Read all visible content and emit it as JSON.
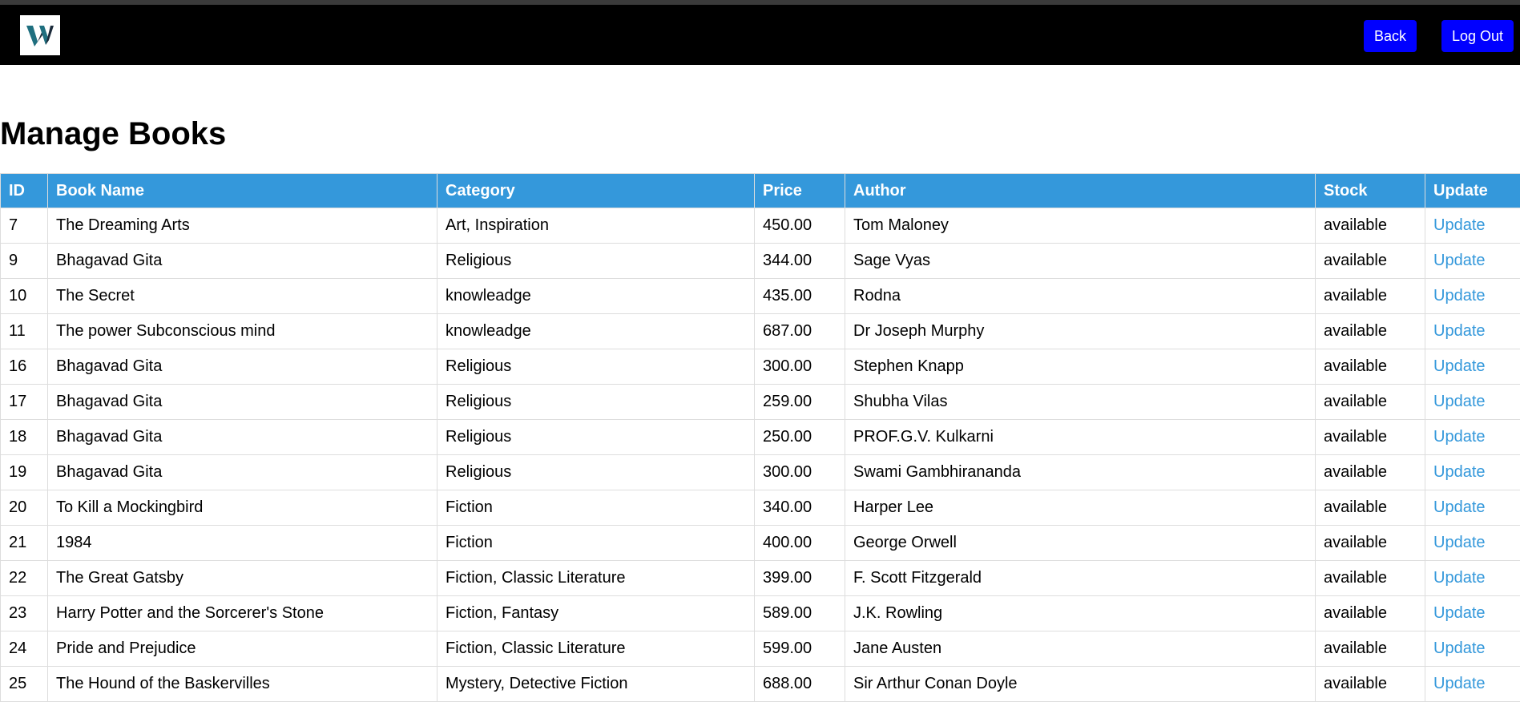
{
  "navbar": {
    "back_label": "Back",
    "logout_label": "Log Out"
  },
  "page_title": "Manage Books",
  "table": {
    "headers": [
      "ID",
      "Book Name",
      "Category",
      "Price",
      "Author",
      "Stock",
      "Update"
    ],
    "rows": [
      {
        "id": "7",
        "name": "The Dreaming Arts",
        "category": "Art, Inspiration",
        "price": "450.00",
        "author": "Tom Maloney",
        "stock": "available",
        "action": "Update"
      },
      {
        "id": "9",
        "name": "Bhagavad Gita",
        "category": "Religious",
        "price": "344.00",
        "author": "Sage Vyas",
        "stock": "available",
        "action": "Update"
      },
      {
        "id": "10",
        "name": "The Secret",
        "category": "knowleadge",
        "price": "435.00",
        "author": "Rodna",
        "stock": "available",
        "action": "Update"
      },
      {
        "id": "11",
        "name": "The power Subconscious mind",
        "category": "knowleadge",
        "price": "687.00",
        "author": "Dr Joseph Murphy",
        "stock": "available",
        "action": "Update"
      },
      {
        "id": "16",
        "name": "Bhagavad Gita",
        "category": "Religious",
        "price": "300.00",
        "author": "Stephen Knapp",
        "stock": "available",
        "action": "Update"
      },
      {
        "id": "17",
        "name": "Bhagavad Gita",
        "category": "Religious",
        "price": "259.00",
        "author": "Shubha Vilas",
        "stock": "available",
        "action": "Update"
      },
      {
        "id": "18",
        "name": "Bhagavad Gita",
        "category": "Religious",
        "price": "250.00",
        "author": "PROF.G.V. Kulkarni",
        "stock": "available",
        "action": "Update"
      },
      {
        "id": "19",
        "name": "Bhagavad Gita",
        "category": "Religious",
        "price": "300.00",
        "author": "Swami Gambhirananda",
        "stock": "available",
        "action": "Update"
      },
      {
        "id": "20",
        "name": "To Kill a Mockingbird",
        "category": "Fiction",
        "price": "340.00",
        "author": "Harper Lee",
        "stock": "available",
        "action": "Update"
      },
      {
        "id": "21",
        "name": "1984",
        "category": "Fiction",
        "price": "400.00",
        "author": "George Orwell",
        "stock": "available",
        "action": "Update"
      },
      {
        "id": "22",
        "name": "The Great Gatsby",
        "category": "Fiction, Classic Literature",
        "price": "399.00",
        "author": "F. Scott Fitzgerald",
        "stock": "available",
        "action": "Update"
      },
      {
        "id": "23",
        "name": "Harry Potter and the Sorcerer's Stone",
        "category": "Fiction, Fantasy",
        "price": "589.00",
        "author": "J.K. Rowling",
        "stock": "available",
        "action": "Update"
      },
      {
        "id": "24",
        "name": "Pride and Prejudice",
        "category": "Fiction, Classic Literature",
        "price": "599.00",
        "author": "Jane Austen",
        "stock": "available",
        "action": "Update"
      },
      {
        "id": "25",
        "name": "The Hound of the Baskervilles",
        "category": "Mystery, Detective Fiction",
        "price": "688.00",
        "author": "Sir Arthur Conan Doyle",
        "stock": "available",
        "action": "Update"
      }
    ]
  },
  "colors": {
    "navbar": "#000000",
    "button": "#0000ff",
    "table_header": "#3498db",
    "link": "#3498db"
  }
}
